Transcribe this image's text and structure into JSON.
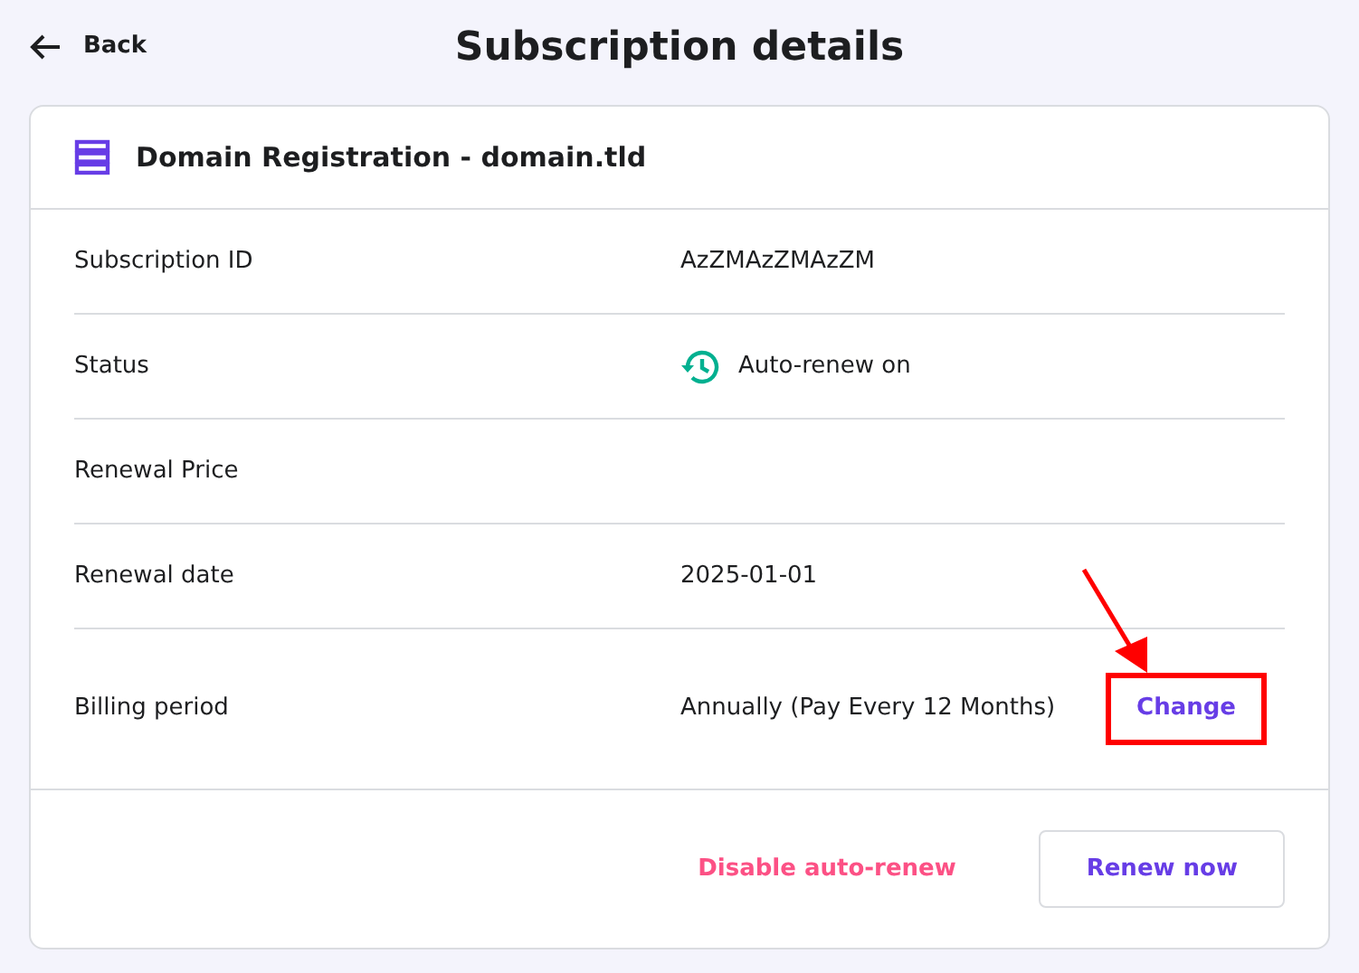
{
  "header": {
    "back": "Back",
    "title": "Subscription details"
  },
  "card": {
    "title": "Domain Registration - domain.tld",
    "rows": [
      {
        "kind": "text",
        "label": "Subscription ID",
        "value": "AzZMAzZMAzZM"
      },
      {
        "kind": "status",
        "label": "Status",
        "value": "Auto-renew on"
      },
      {
        "kind": "text",
        "label": "Renewal Price"
      },
      {
        "kind": "text",
        "label": "Renewal date",
        "value": "2025-01-01"
      },
      {
        "kind": "action",
        "label": "Billing period",
        "value": "Annually (Pay Every 12 Months)",
        "action": "Change",
        "highlighted": true
      }
    ],
    "buttons": [
      {
        "kind": "danger-link",
        "label": "Disable auto-renew"
      },
      {
        "kind": "outline",
        "label": "Renew now"
      }
    ]
  }
}
